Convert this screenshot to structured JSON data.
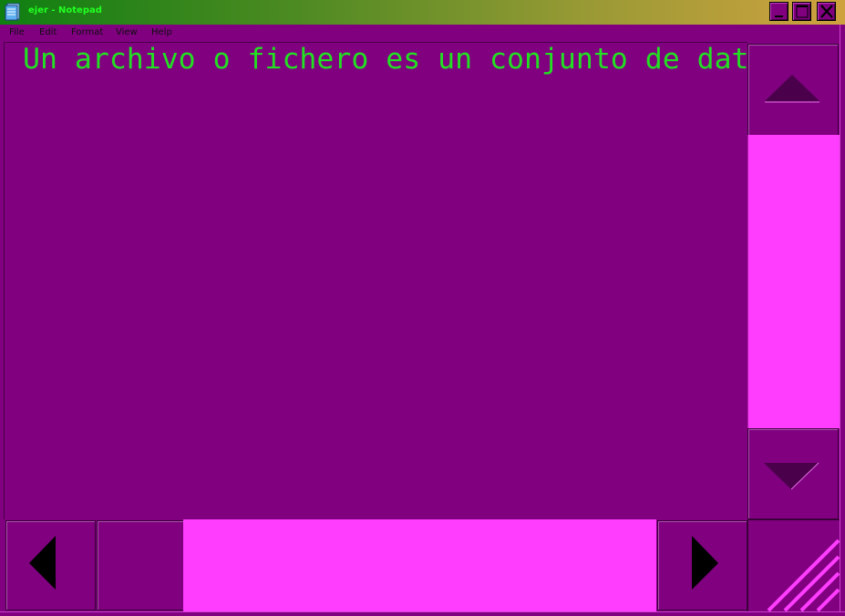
{
  "window": {
    "title": "ejer - Notepad",
    "app_icon": "notepad-icon"
  },
  "title_buttons": {
    "minimize_icon": "minimize-icon",
    "maximize_icon": "maximize-icon",
    "close_icon": "close-icon"
  },
  "menu": {
    "file": "File",
    "edit": "Edit",
    "format": "Format",
    "view": "View",
    "help": "Help"
  },
  "editor": {
    "text": "Un archivo o fichero es un conjunto de datos"
  },
  "scrollbars": {
    "up_icon": "arrow-up-icon",
    "down_icon": "arrow-down-icon",
    "left_icon": "arrow-left-icon",
    "right_icon": "arrow-right-icon"
  },
  "colors": {
    "window_bg": "#800080",
    "text": "#22e022",
    "scroll_thumb": "#ff3dff",
    "title_text": "#22ff22"
  }
}
